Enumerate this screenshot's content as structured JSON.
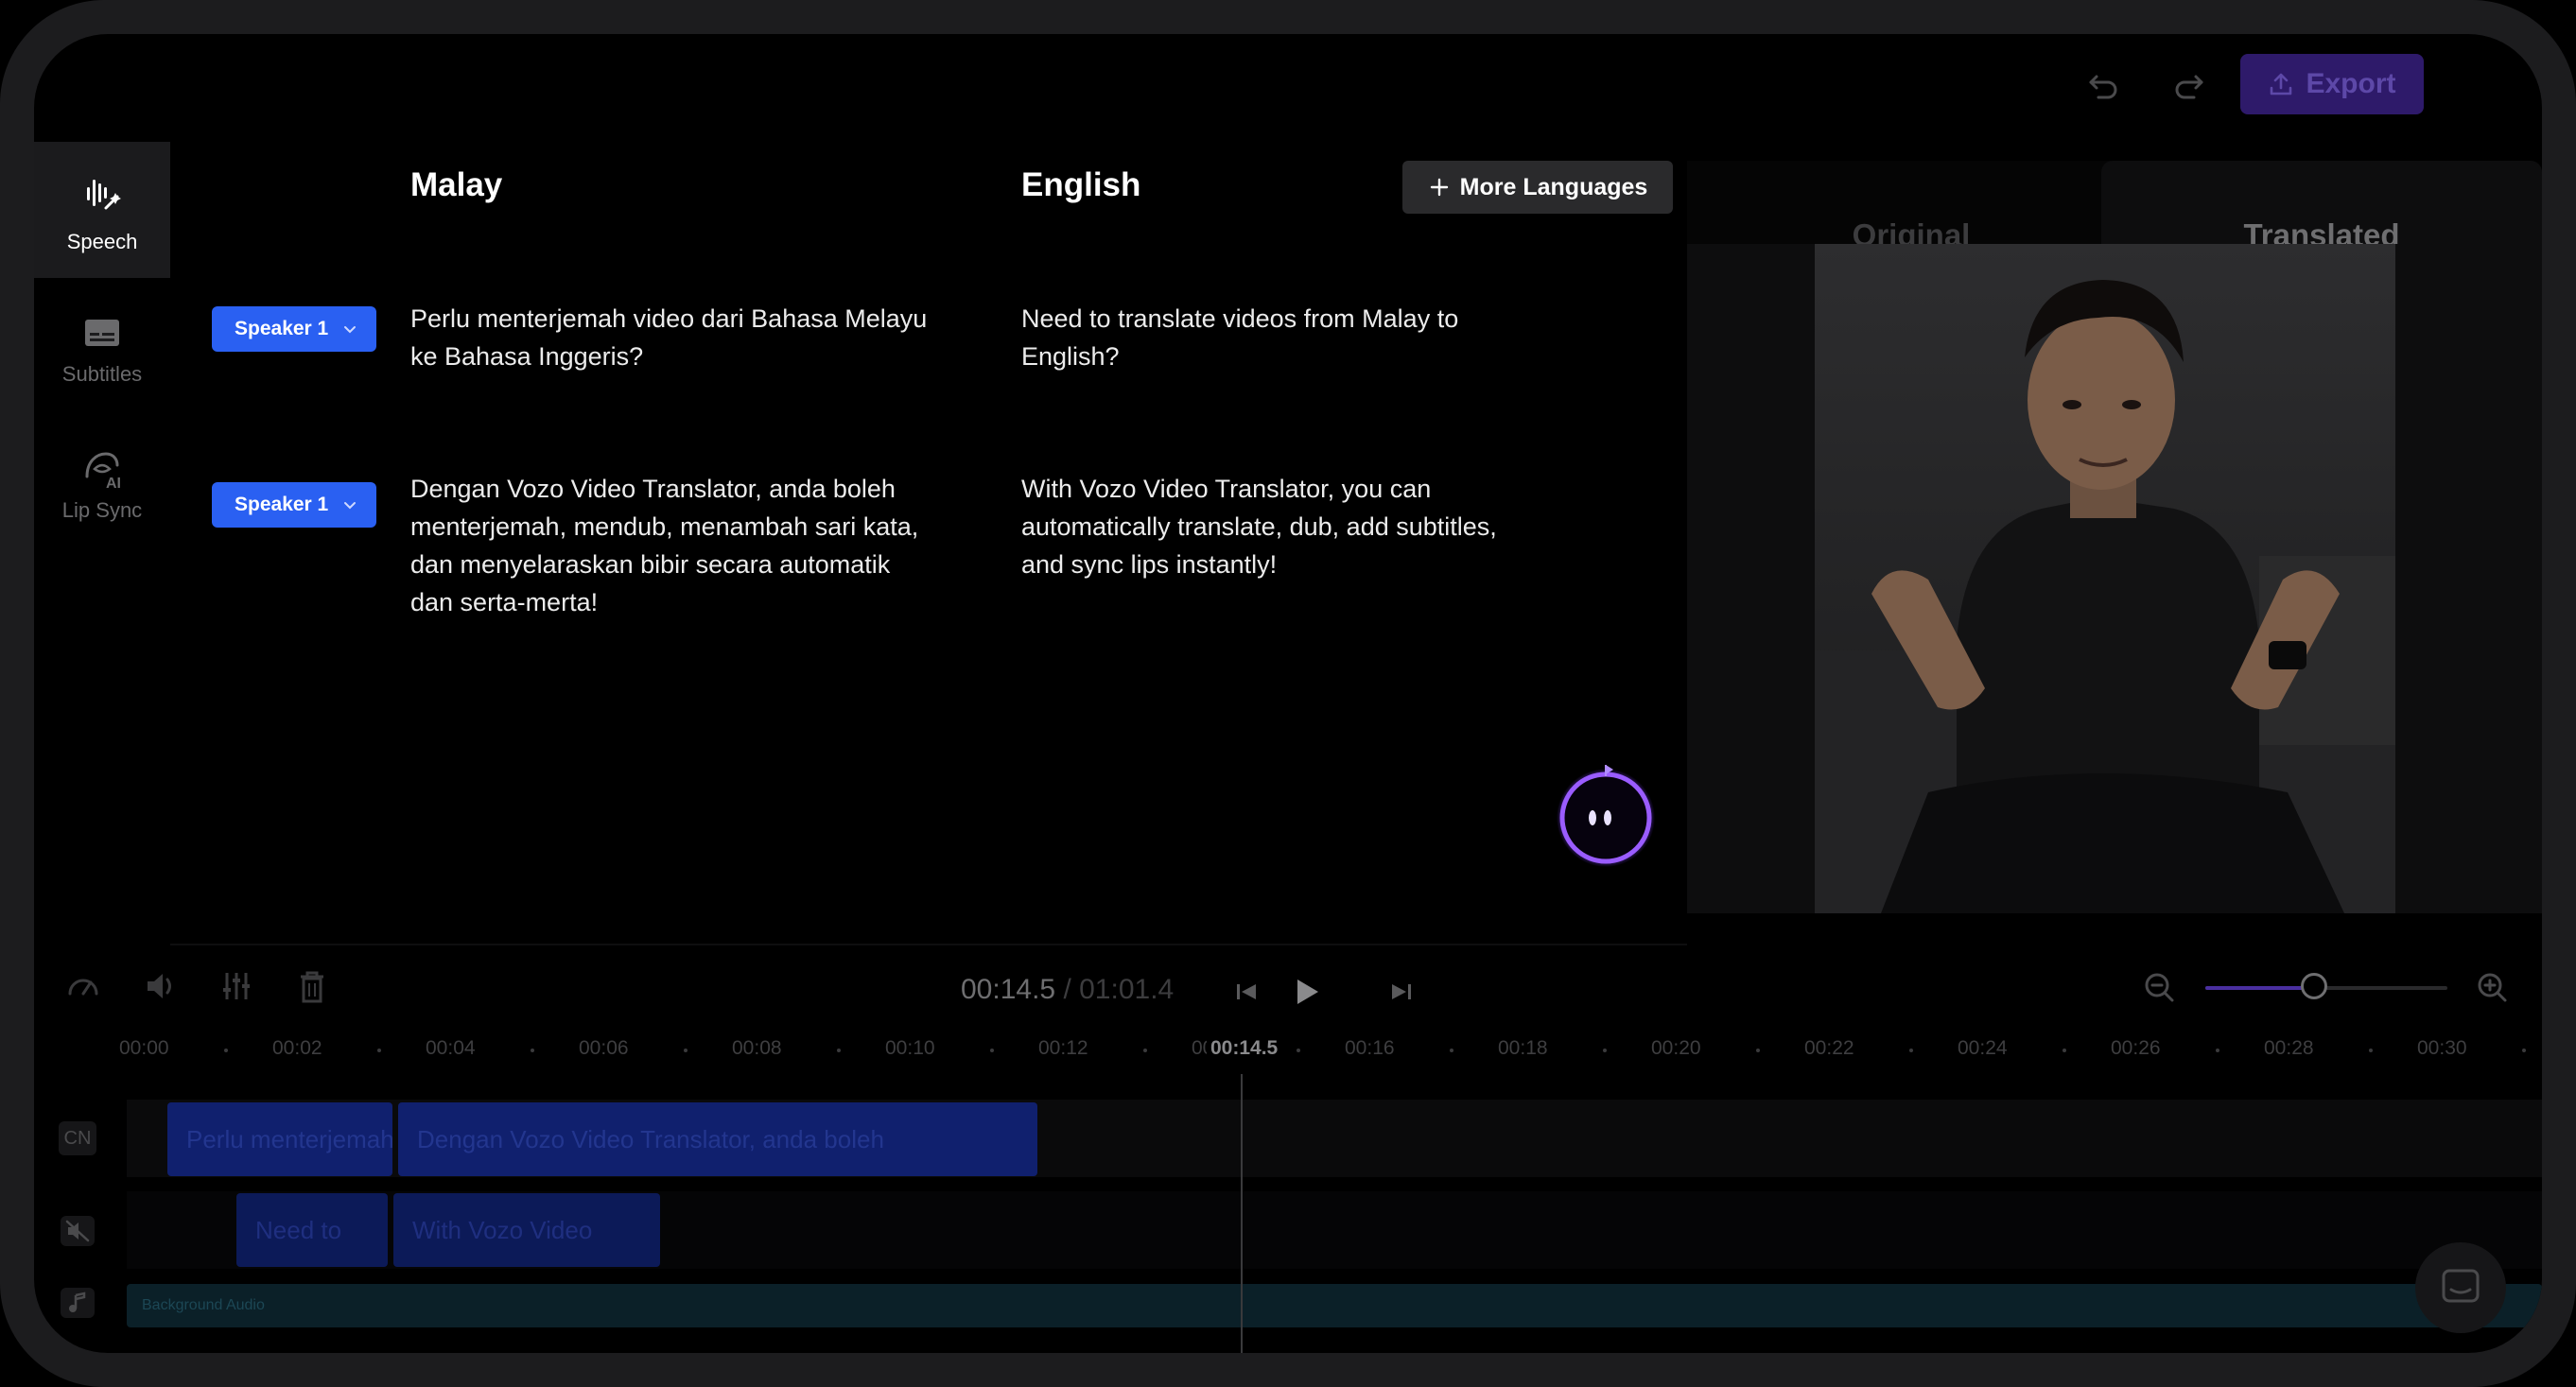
{
  "header": {
    "export_label": "Export"
  },
  "sidebar": {
    "items": [
      {
        "label": "Speech",
        "icon": "speech-waveform-icon"
      },
      {
        "label": "Subtitles",
        "icon": "subtitles-icon"
      },
      {
        "label": "Lip Sync",
        "icon": "lip-sync-icon"
      }
    ]
  },
  "editor": {
    "source_language": "Malay",
    "target_language": "English",
    "more_languages_label": "More Languages",
    "segments": [
      {
        "speaker": "Speaker 1",
        "source": [
          "Perlu menterjemah video dari Bahasa Melayu",
          "ke Bahasa Inggeris?"
        ],
        "target": [
          "Need to translate videos from Malay to",
          "English?"
        ]
      },
      {
        "speaker": "Speaker 1",
        "source": [
          "Dengan Vozo Video Translator, anda boleh",
          "menterjemah, mendub, menambah sari kata,",
          "dan menyelaraskan bibir secara automatik",
          "dan serta-merta!"
        ],
        "target": [
          "With Vozo Video Translator, you can",
          "automatically translate, dub, add subtitles,",
          "and sync lips instantly!"
        ]
      }
    ]
  },
  "preview": {
    "tab_original": "Original",
    "tab_translated": "Translated"
  },
  "player": {
    "current_time": "00:14.5",
    "separator": "/",
    "total_time": "01:01.4",
    "zoom_level": 0.45
  },
  "timeline": {
    "ticks": [
      "00:00",
      "00:02",
      "00:04",
      "00:06",
      "00:08",
      "00:10",
      "00:12",
      "00:14",
      "00:16",
      "00:18",
      "00:20",
      "00:22",
      "00:24",
      "00:26",
      "00:28",
      "00:30"
    ],
    "playhead_label": "00:14.5",
    "track_cn_label": "CN",
    "cn_clips": [
      "Perlu menterjemah",
      "Dengan Vozo Video Translator, anda boleh"
    ],
    "en_clips": [
      "Need to",
      "With Vozo Video"
    ],
    "background_audio_label": "Background Audio"
  },
  "colors": {
    "accent_blue": "#2a60f2",
    "export_purple": "#2e1a6a",
    "mascot_purple": "#8a4dff"
  }
}
